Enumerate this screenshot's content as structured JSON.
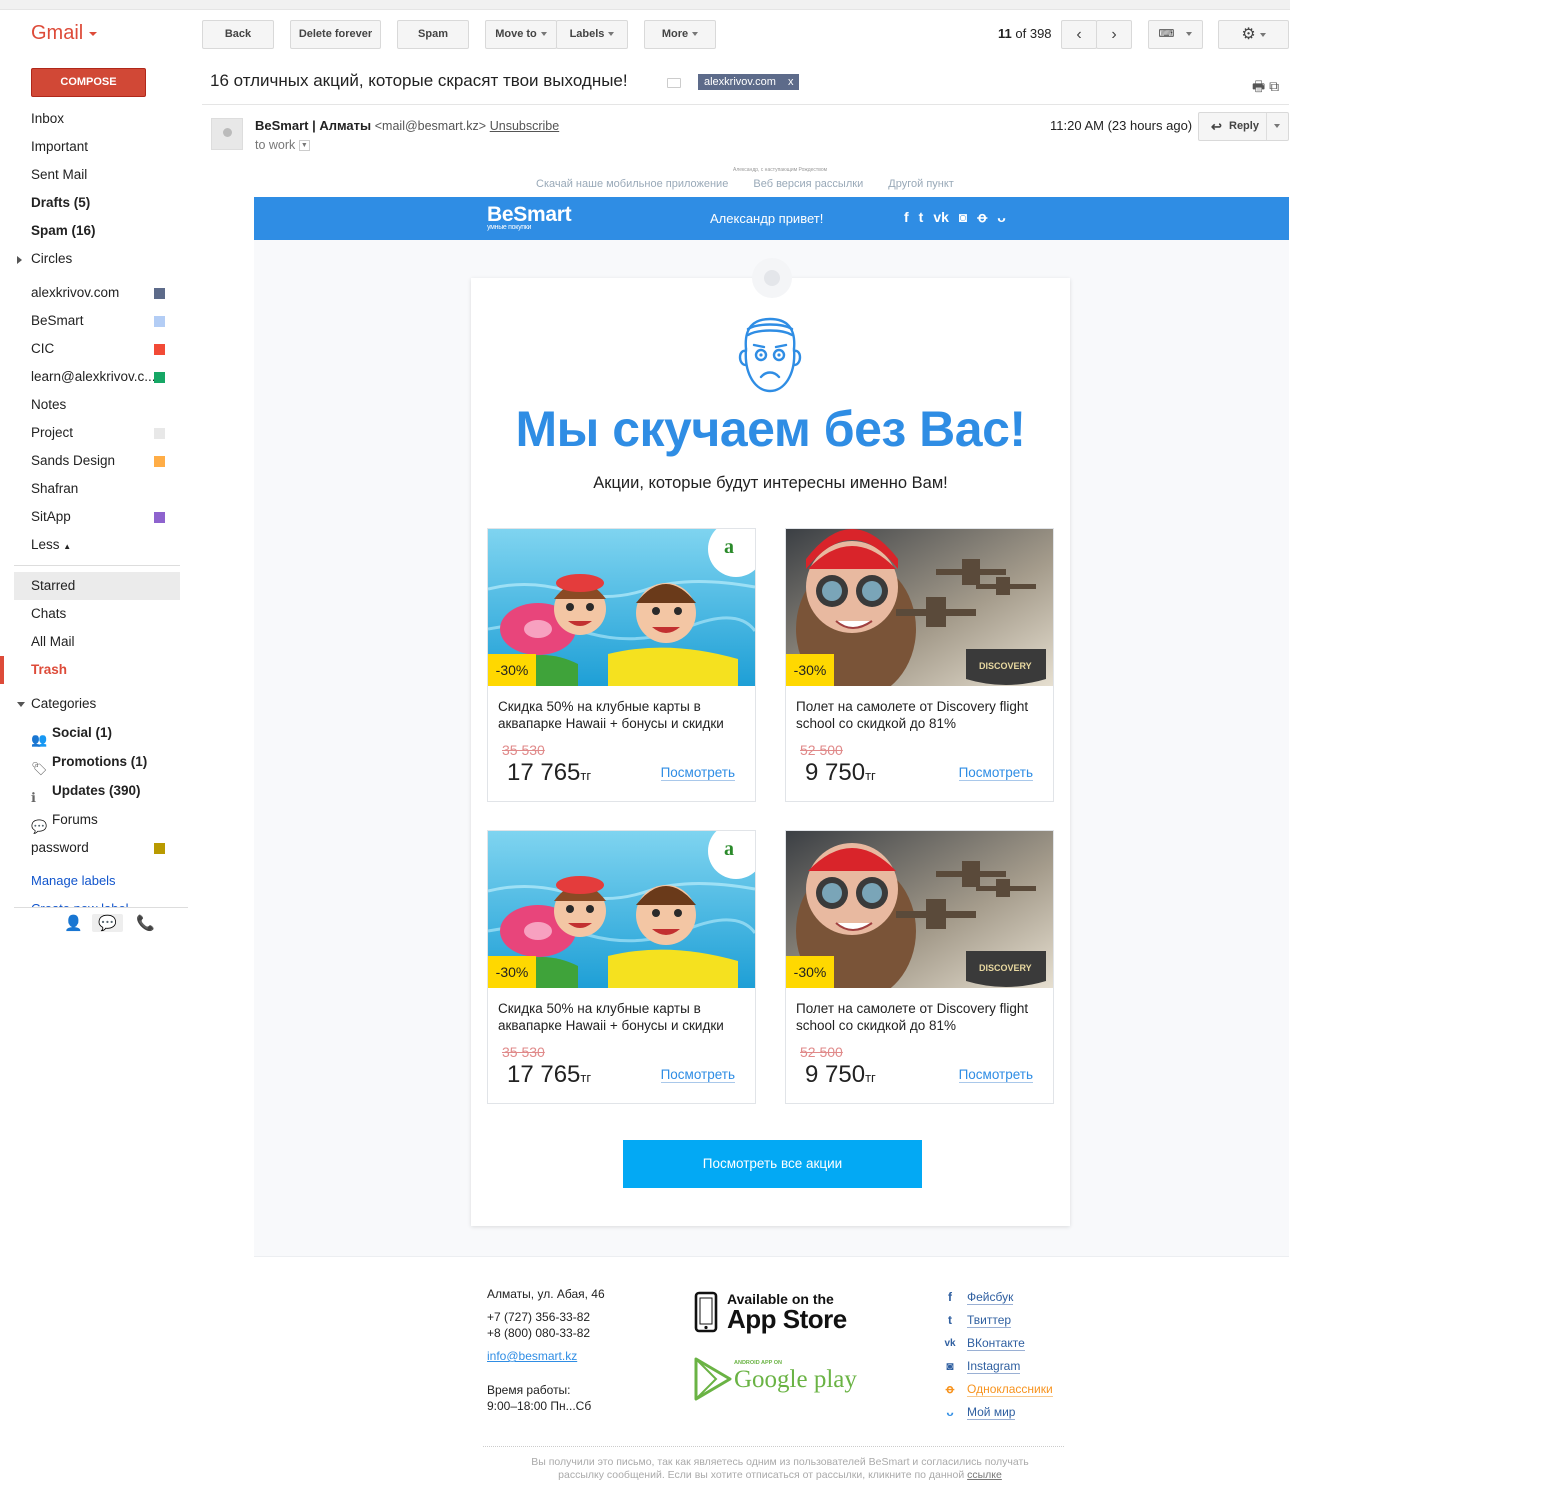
{
  "app": {
    "brand": "Gmail"
  },
  "compose_label": "COMPOSE",
  "nav": {
    "items": [
      {
        "label": "Inbox",
        "bold": false
      },
      {
        "label": "Important",
        "bold": false
      },
      {
        "label": "Sent Mail",
        "bold": false
      },
      {
        "label": "Drafts (5)",
        "bold": true
      },
      {
        "label": "Spam (16)",
        "bold": true
      },
      {
        "label": "Circles",
        "bold": false
      }
    ],
    "labels": [
      {
        "label": "alexkrivov.com",
        "color": "#5d6b8a"
      },
      {
        "label": "BeSmart",
        "color": "#b3cdf5"
      },
      {
        "label": "CIC",
        "color": "#f24a36"
      },
      {
        "label": "learn@alexkrivov.c...",
        "color": "#16a765"
      },
      {
        "label": "Notes",
        "color": ""
      },
      {
        "label": "Project",
        "color": "#e8e8e8"
      },
      {
        "label": "Sands Design",
        "color": "#ffad46"
      },
      {
        "label": "Shafran",
        "color": ""
      },
      {
        "label": "SitApp",
        "color": "#8e63ce"
      }
    ],
    "less": "Less",
    "system": [
      "Starred",
      "Chats",
      "All Mail",
      "Trash"
    ],
    "categories_label": "Categories",
    "categories": [
      {
        "label": "Social (1)",
        "icon": "people-icon"
      },
      {
        "label": "Promotions (1)",
        "icon": "tag-icon"
      },
      {
        "label": "Updates (390)",
        "icon": "info-icon"
      },
      {
        "label": "Forums",
        "icon": "forum-icon"
      }
    ],
    "password_label": "password",
    "password_color": "#b99a00",
    "manage_labels": "Manage labels",
    "create_label": "Create new label"
  },
  "toolbar": {
    "back": "Back",
    "delete_forever": "Delete forever",
    "spam": "Spam",
    "move_to": "Move to",
    "labels": "Labels",
    "more": "More",
    "pager_current": "11",
    "pager_of": "of",
    "pager_total": "398"
  },
  "message": {
    "subject": "16 отличных акций, которые скрасят твои выходные!",
    "tag": "alexkrivov.com",
    "tag_close": "x",
    "sender_name": "BeSmart | Алматы",
    "sender_email": "<mail@besmart.kz>",
    "unsubscribe": "Unsubscribe",
    "to": "to work",
    "time": "11:20 AM (23 hours ago)",
    "reply": "Reply"
  },
  "email": {
    "tiny_note": "Александр, с наступающим Рождеством",
    "prelinks": [
      "Скачай наше мобильное приложение",
      "Веб версия рассылки",
      "Другой пункт"
    ],
    "logo": "BeSmart",
    "logo_tagline": "умные покупки",
    "greeting": "Александр привет!",
    "headline": "Мы скучаем без Вас!",
    "subheadline": "Акции, которые будут интересны именно Вам!",
    "deals": [
      {
        "badge": "-30%",
        "title": "Скидка 50% на клубные карты в аквапарке Hawaii + бонусы и скидки",
        "old_price": "35 530",
        "price": "17 765",
        "currency": "тг",
        "link": "Посмотреть",
        "image": "waterpark"
      },
      {
        "badge": "-30%",
        "title": "Полет на самолете от Discovery flight school со скидкой до 81%",
        "old_price": "52 500",
        "price": "9 750",
        "currency": "тг",
        "link": "Посмотреть",
        "image": "flight"
      },
      {
        "badge": "-30%",
        "title": "Скидка 50% на клубные карты в аквапарке Hawaii + бонусы и скидки",
        "old_price": "35 530",
        "price": "17 765",
        "currency": "тг",
        "link": "Посмотреть",
        "image": "waterpark"
      },
      {
        "badge": "-30%",
        "title": "Полет на самолете от Discovery flight school со скидкой до 81%",
        "old_price": "52 500",
        "price": "9 750",
        "currency": "тг",
        "link": "Посмотреть",
        "image": "flight"
      }
    ],
    "cta": "Посмотреть все акции",
    "address": "Алматы, ул. Абая, 46",
    "phone1": "+7 (727) 356-33-82",
    "phone2": "+8 (800) 080-33-82",
    "email": "info@besmart.kz",
    "hours_label": "Время работы:",
    "hours": "9:00–18:00   Пн...Сб",
    "appstore_line1": "Available on the",
    "appstore_line2": "App Store",
    "gplay_small": "ANDROID APP ON",
    "gplay_big": "Google play",
    "social_links": [
      {
        "label": "Фейсбук",
        "icon": "facebook-icon",
        "color": "#2f5fa0"
      },
      {
        "label": "Твиттер",
        "icon": "twitter-icon",
        "color": "#2f5fa0"
      },
      {
        "label": "ВКонтакте",
        "icon": "vk-icon",
        "color": "#2f5fa0"
      },
      {
        "label": "Instagram",
        "icon": "instagram-icon",
        "color": "#2f5fa0"
      },
      {
        "label": "Одноклассники",
        "icon": "ok-icon",
        "color": "#f7931e"
      },
      {
        "label": "Мой мир",
        "icon": "moimir-icon",
        "color": "#2f5fa0"
      }
    ],
    "unsub_text_1": "Вы получили это письмо, так как являетесь одним из пользователей BeSmart и согласились получать",
    "unsub_text_2": "рассылку сообщений. Если вы хотите отписаться от рассылки, кликните по данной",
    "unsub_link": "ссылке"
  },
  "colors": {
    "accent": "#2f8de4",
    "compose": "#d14836",
    "badge": "#ffd800",
    "cta": "#03a9f4"
  }
}
